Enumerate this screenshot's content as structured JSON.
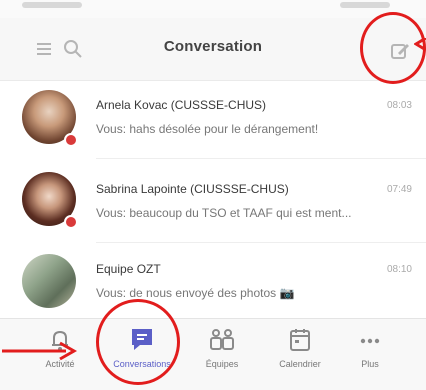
{
  "header": {
    "title": "Conversation"
  },
  "conversations": [
    {
      "name": "Arnela Kovac (CUSSSE-CHUS)",
      "preview": "Vous: hahs désolée pour le dérangement!",
      "time": "08:03"
    },
    {
      "name": "Sabrina Lapointe (CIUSSSE-CHUS)",
      "preview": "Vous: beaucoup du TSO et TAAF qui est ment...",
      "time": "07:49"
    },
    {
      "name": "Equipe OZT",
      "preview": "Vous: de nous envoyé des photos 📷",
      "time": "08:10"
    }
  ],
  "tabs": [
    {
      "label": "Activité",
      "icon": "bell-icon"
    },
    {
      "label": "Conversations",
      "icon": "chat-icon"
    },
    {
      "label": "Équipes",
      "icon": "teams-icon"
    },
    {
      "label": "Calendrier",
      "icon": "calendar-icon"
    },
    {
      "label": "Plus",
      "icon": "more-icon"
    }
  ],
  "colors": {
    "accent": "#5b5fc7",
    "annotation": "#e21d1d",
    "presence_busy": "#d93a3a"
  }
}
